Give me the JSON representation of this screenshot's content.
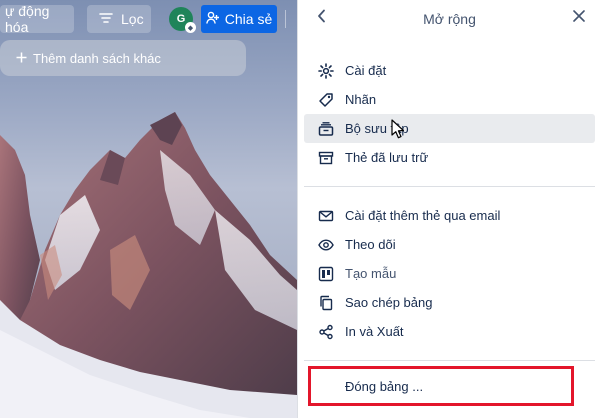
{
  "board": {
    "automation_label": "ự động hóa",
    "filter_label": "Lọc",
    "avatar_initial": "G",
    "share_label": "Chia sẻ",
    "add_list_label": "Thêm danh sách khác"
  },
  "panel": {
    "title": "Mở rộng",
    "group1": [
      {
        "label": "Cài đặt",
        "icon": "gear-icon"
      },
      {
        "label": "Nhãn",
        "icon": "label-icon"
      },
      {
        "label": "Bộ sưu tập",
        "icon": "collection-icon"
      },
      {
        "label": "Thẻ đã lưu trữ",
        "icon": "archive-icon"
      }
    ],
    "group2": [
      {
        "label": "Cài đặt thêm thẻ qua email",
        "icon": "email-icon"
      },
      {
        "label": "Theo dõi",
        "icon": "eye-icon"
      },
      {
        "label": "Tạo mẫu",
        "icon": "template-icon"
      },
      {
        "label": "Sao chép bảng",
        "icon": "copy-icon"
      },
      {
        "label": "In và Xuất",
        "icon": "share-icon"
      }
    ],
    "close_board_label": "Đóng bảng ..."
  },
  "colors": {
    "accent": "#0c66e4",
    "avatar": "#1f845a",
    "highlight_border": "#e3162b",
    "hover_bg": "#e9ebee"
  }
}
